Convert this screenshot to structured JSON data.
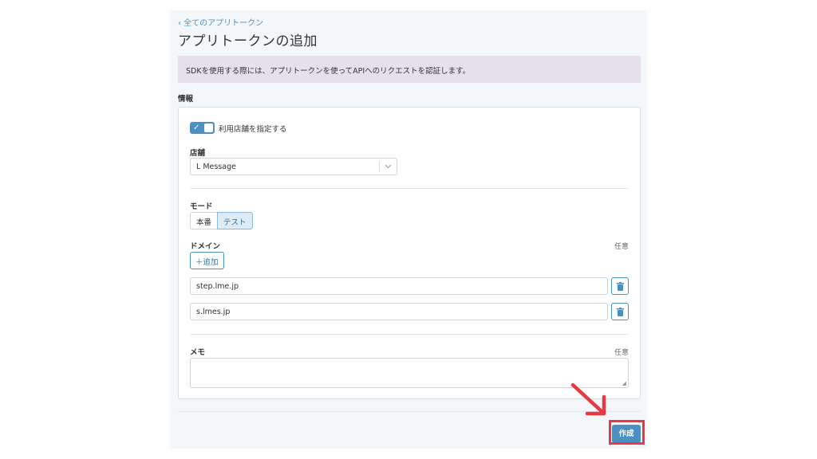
{
  "breadcrumb": "‹ 全てのアプリトークン",
  "page_title": "アプリトークンの追加",
  "notice": "SDKを使用する際には、アプリトークンを使ってAPIへのリクエストを認証します。",
  "section_label": "情報",
  "store_toggle": {
    "label": "利用店舗を指定する",
    "checked": true
  },
  "store": {
    "label": "店舗",
    "selected": "L Message"
  },
  "mode": {
    "label": "モード",
    "options": [
      "本番",
      "テスト"
    ],
    "selected": "テスト"
  },
  "domain": {
    "label": "ドメイン",
    "optional": "任意",
    "add_label": "＋追加",
    "entries": [
      "step.lme.jp",
      "s.lmes.jp"
    ]
  },
  "memo": {
    "label": "メモ",
    "optional": "任意",
    "value": ""
  },
  "create_label": "作成",
  "colors": {
    "accent": "#4a90c2",
    "notice_bg": "#e6e0ea",
    "annotation": "#e63946"
  },
  "icons": [
    "check-icon",
    "chevron-down-icon",
    "trash-icon",
    "resize-grip-icon",
    "annotation-arrow-icon"
  ]
}
